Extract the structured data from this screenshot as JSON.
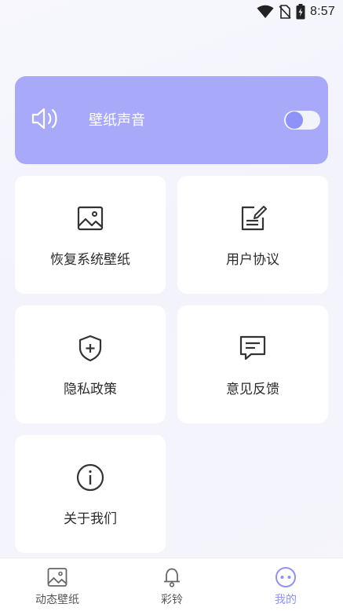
{
  "status_bar": {
    "time": "8:57",
    "icons": [
      "wifi-icon",
      "no-sim-icon",
      "battery-charging-icon"
    ]
  },
  "sound_card": {
    "icon": "speaker-icon",
    "label": "壁纸声音",
    "toggle_on": false,
    "bg_color": "#a8aaf9",
    "knob_color": "#8f92f6"
  },
  "tiles": [
    {
      "icon": "image-icon",
      "label": "恢复系统壁纸"
    },
    {
      "icon": "edit-document-icon",
      "label": "用户协议"
    },
    {
      "icon": "shield-plus-icon",
      "label": "隐私政策"
    },
    {
      "icon": "message-icon",
      "label": "意见反馈"
    },
    {
      "icon": "info-icon",
      "label": "关于我们"
    }
  ],
  "bottom_nav": {
    "items": [
      {
        "icon": "image-icon",
        "label": "动态壁纸",
        "active": false
      },
      {
        "icon": "bell-icon",
        "label": "彩铃",
        "active": false
      },
      {
        "icon": "face-icon",
        "label": "我的",
        "active": true
      }
    ],
    "active_color": "#8f92f6"
  }
}
